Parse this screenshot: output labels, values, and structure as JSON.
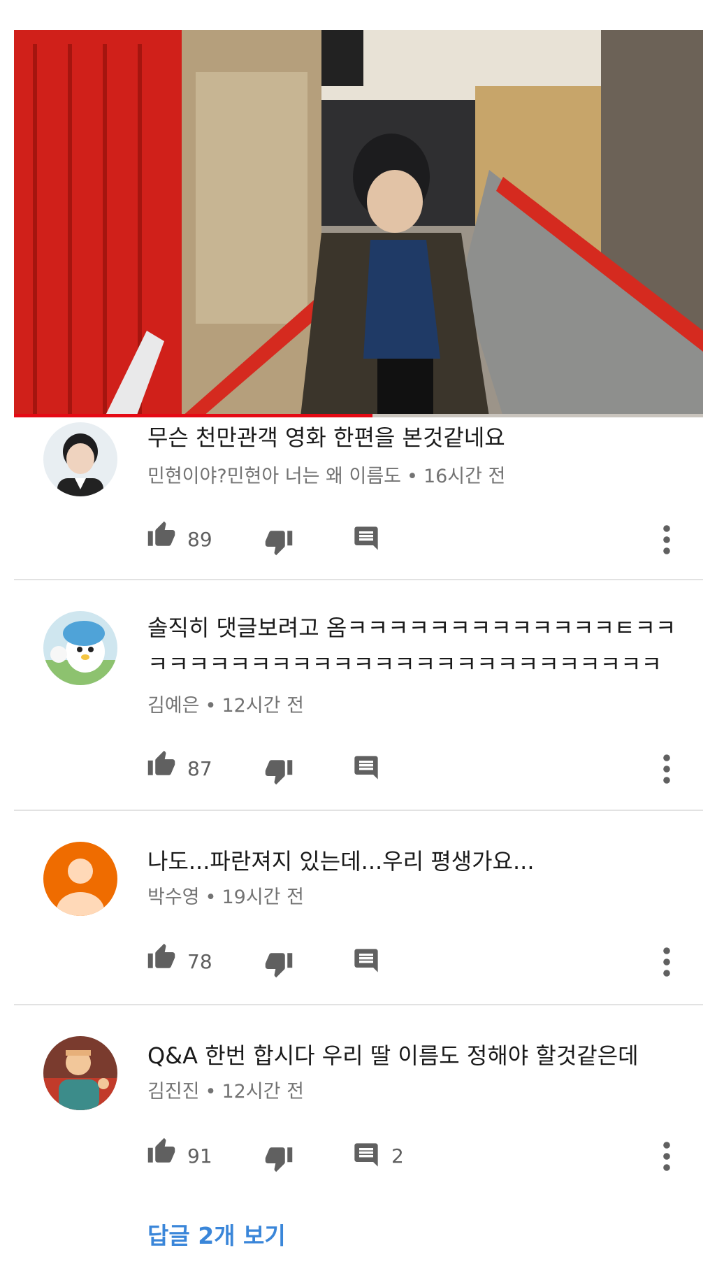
{
  "video": {
    "progress": 0.52,
    "colors": {
      "accent": "#e50914",
      "rail": "#d6261b"
    }
  },
  "comments": [
    {
      "author": "민현이야?민현아 너는 왜 이름도",
      "time": "16시간 전",
      "text": "무슨 천만관객 영화 한편을 본것같네요",
      "likes": "89",
      "replies": "",
      "avatar_icon": "portrait-avatar"
    },
    {
      "author": "김예은",
      "time": "12시간 전",
      "text": "솔직히 댓글보려고 옴ㅋㅋㅋㅋㅋㅋㅋㅋㅋㅋㅋㅋㅋㅌㅋㅋ\nㅋㅋㅋㅋㅋㅋㅋㅋㅋㅋㅋㅋㅋㅋㅋㅋㅋㅋㅋㅋㅋㅋㅋㅋㅋ",
      "likes": "87",
      "replies": "",
      "avatar_icon": "cartoon-penguin-avatar"
    },
    {
      "author": "박수영",
      "time": "19시간 전",
      "text": "나도...파란져지 있는데...우리 평생가요...",
      "likes": "78",
      "replies": "",
      "avatar_icon": "default-user-avatar"
    },
    {
      "author": "김진진",
      "time": "12시간 전",
      "text": "Q&A 한번 합시다 우리 딸 이름도 정해야 할것같은데",
      "likes": "91",
      "replies": "2",
      "avatar_icon": "cartoon-man-avatar"
    }
  ],
  "separator": "•",
  "view_replies_label": "답글 2개 보기"
}
